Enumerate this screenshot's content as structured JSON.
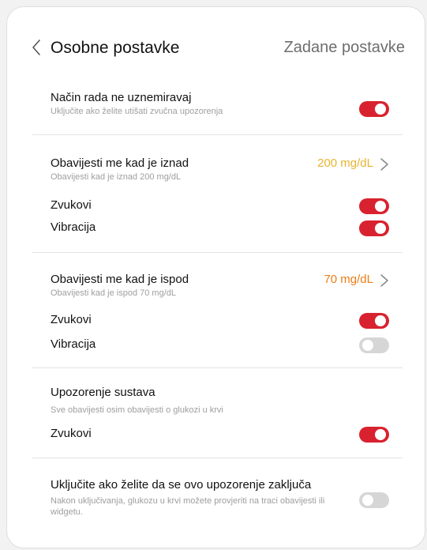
{
  "header": {
    "title": "Osobne postavke",
    "action": "Zadane postavke"
  },
  "dnd": {
    "title": "Način rada ne uznemiravaj",
    "subtitle": "Uključite ako želite utišati zvučna upozorenja",
    "enabled": true
  },
  "high": {
    "title": "Obavijesti me kad je iznad",
    "subtitle": "Obavijesti kad je iznad 200 mg/dL",
    "value": "200 mg/dL",
    "value_color": "#e8b531",
    "sounds_label": "Zvukovi",
    "sounds_enabled": true,
    "vibration_label": "Vibracija",
    "vibration_enabled": true
  },
  "low": {
    "title": "Obavijesti me kad je ispod",
    "subtitle": "Obavijesti kad je ispod 70 mg/dL",
    "value": "70 mg/dL",
    "value_color": "#ec7d17",
    "sounds_label": "Zvukovi",
    "sounds_enabled": true,
    "vibration_label": "Vibracija",
    "vibration_enabled": false
  },
  "system": {
    "title": "Upozorenje sustava",
    "subtitle": "Sve obavijesti osim obavijesti o glukozi u krvi",
    "sounds_label": "Zvukovi",
    "sounds_enabled": true
  },
  "lock": {
    "title": "Uključite ako želite da se ovo upozorenje zaključa",
    "subtitle": "Nakon uključivanja, glukozu u krvi možete provjeriti na traci obavijesti ili widgetu.",
    "enabled": false
  },
  "colors": {
    "toggle_on": "#d9222f",
    "toggle_off": "#d6d6d6"
  }
}
